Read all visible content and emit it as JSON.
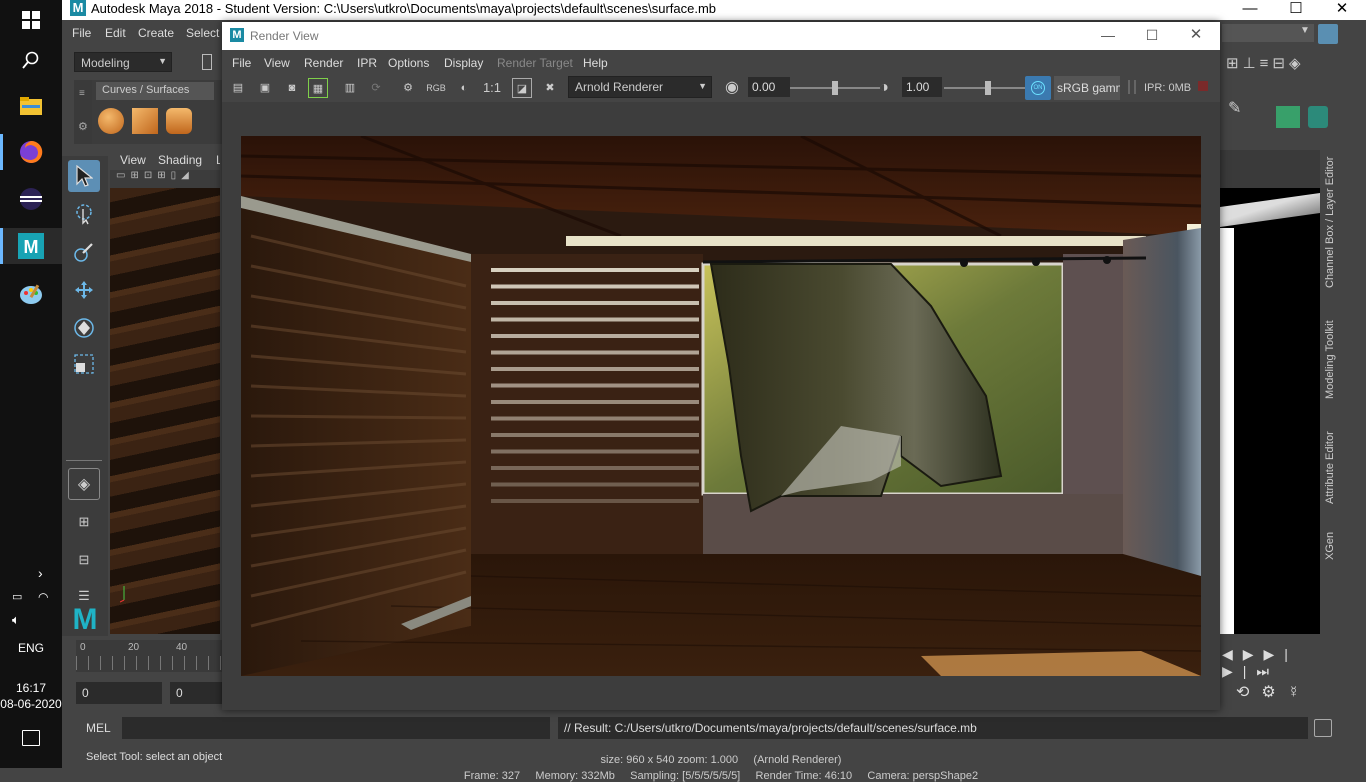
{
  "taskbar": {
    "items": [
      {
        "icon": "windows-start-icon"
      },
      {
        "icon": "search-icon"
      },
      {
        "icon": "file-explorer-icon"
      },
      {
        "icon": "firefox-icon"
      },
      {
        "icon": "eclipse-icon"
      },
      {
        "icon": "maya-icon"
      },
      {
        "icon": "paint-icon"
      }
    ],
    "language": "ENG",
    "time": "16:17",
    "date": "08-06-2020"
  },
  "maya": {
    "title": "Autodesk Maya 2018 - Student Version: C:\\Users\\utkro\\Documents\\maya\\projects\\default\\scenes\\surface.mb",
    "menu": [
      "File",
      "Edit",
      "Create",
      "Select"
    ],
    "workspace": "Modeling",
    "shelf_tab": "Curves / Surfaces",
    "viewport_menu": [
      "View",
      "Shading",
      "L"
    ],
    "timeline_ticks": [
      "0",
      "20",
      "40"
    ],
    "range_start": "0",
    "range_start2": "0",
    "cmd_lang": "MEL",
    "cmd_result": "// Result: C:/Users/utkro/Documents/maya/projects/default/scenes/surface.mb",
    "status_line": "Select Tool: select an object",
    "right_tabs": [
      "Channel Box / Layer Editor",
      "Modeling Toolkit",
      "Attribute Editor",
      "XGen"
    ]
  },
  "render_view": {
    "title": "Render View",
    "menu": [
      "File",
      "View",
      "Render",
      "IPR",
      "Options",
      "Display",
      "Render Target",
      "Help"
    ],
    "toolbar": {
      "rgb_label": "RGB",
      "ratio_label": "1:1",
      "renderer": "Arnold Renderer",
      "exposure": "0.00",
      "gamma": "1.00",
      "color_space": "sRGB gamm",
      "ipr_mem": "IPR: 0MB",
      "exposure_level": 0.5,
      "gamma_level": 0.5
    },
    "info_line1": "size: 960 x 540 zoom: 1.000     (Arnold Renderer)",
    "info_line2": "Frame: 327     Memory: 332Mb     Sampling: [5/5/5/5/5/5]     Render Time: 46:10     Camera: perspShape2"
  },
  "colors": {
    "maya_bg": "#444444",
    "accent_teal": "#1a8aa3",
    "wood_dark": "#3a2112",
    "curtain": "#3b3a22"
  }
}
